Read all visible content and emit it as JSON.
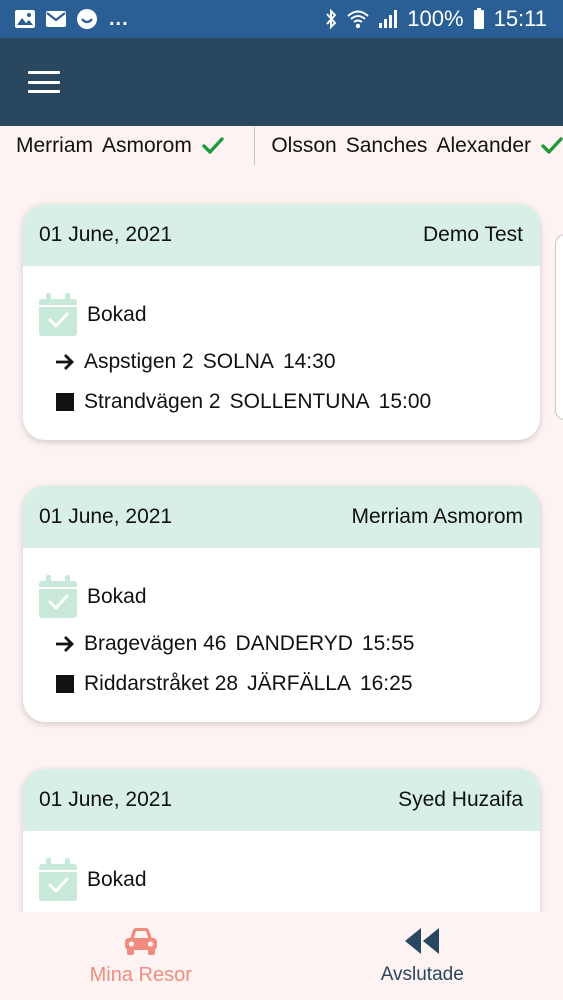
{
  "status_bar": {
    "battery": "100%",
    "time": "15:11",
    "more": "..."
  },
  "drivers": [
    {
      "first": "Merriam",
      "last": "Asmorom",
      "middle": ""
    },
    {
      "first": "Olsson",
      "middle": "Sanches",
      "last": "Alexander"
    }
  ],
  "trips": [
    {
      "date": "01 June, 2021",
      "name": "Demo Test",
      "status": "Bokad",
      "from": {
        "street": "Aspstigen 2",
        "city": "SOLNA",
        "time": "14:30"
      },
      "to": {
        "street": "Strandvägen 2",
        "city": "SOLLENTUNA",
        "time": "15:00"
      }
    },
    {
      "date": "01 June, 2021",
      "name": "Merriam Asmorom",
      "status": "Bokad",
      "from": {
        "street": "Bragevägen 46",
        "city": "DANDERYD",
        "time": "15:55"
      },
      "to": {
        "street": "Riddarstråket 28",
        "city": "JÄRFÄLLA",
        "time": "16:25"
      }
    },
    {
      "date": "01 June, 2021",
      "name": "Syed Huzaifa",
      "status": "Bokad"
    }
  ],
  "bottom_nav": {
    "items": [
      {
        "label": "Mina Resor",
        "icon": "car-icon",
        "active": true
      },
      {
        "label": "Avslutade",
        "icon": "rewind-icon",
        "active": false
      }
    ]
  },
  "colors": {
    "status_bar": "#2a5f95",
    "app_bar": "#29475f",
    "card_header": "#d7efe6",
    "background": "#fdf3f2",
    "active_nav": "#f08c7e",
    "check": "#1f9a3b",
    "calendar": "#c8e9da"
  }
}
